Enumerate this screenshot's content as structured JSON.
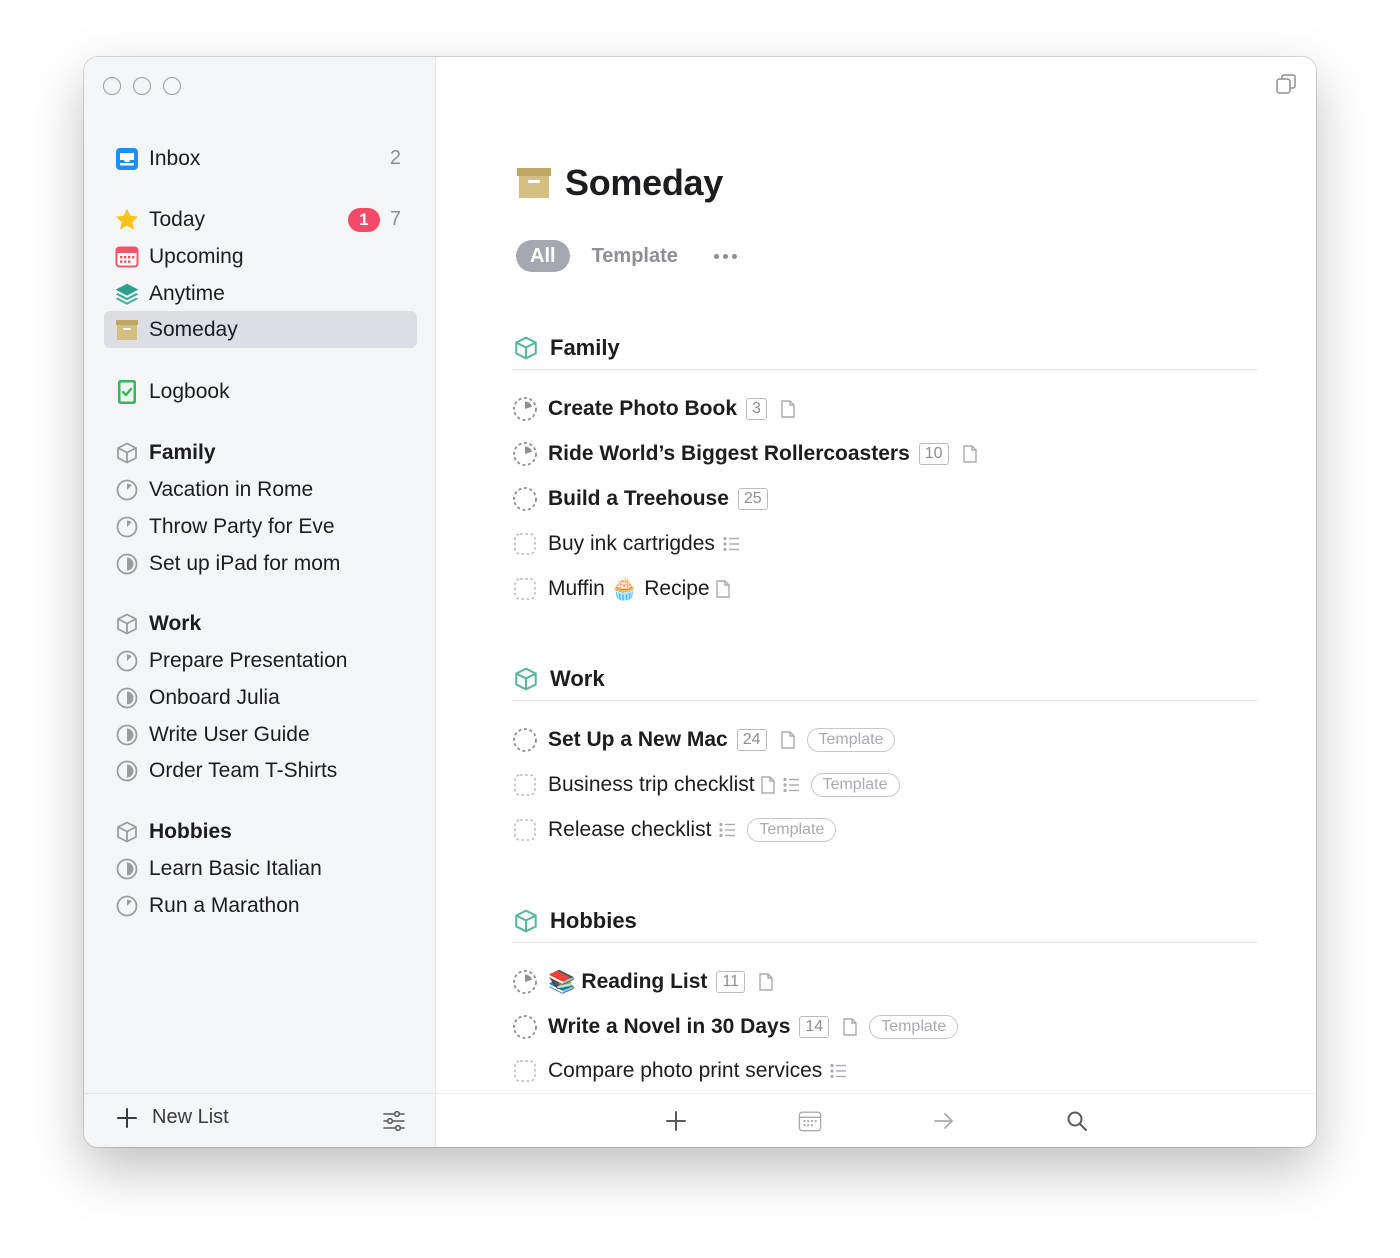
{
  "sidebar": {
    "inbox": {
      "label": "Inbox",
      "count": "2"
    },
    "today": {
      "label": "Today",
      "badge": "1",
      "count": "7"
    },
    "upcoming": {
      "label": "Upcoming"
    },
    "anytime": {
      "label": "Anytime"
    },
    "someday": {
      "label": "Someday"
    },
    "logbook": {
      "label": "Logbook"
    },
    "areas": [
      {
        "label": "Family",
        "projects": [
          "Vacation in Rome",
          "Throw Party for Eve",
          "Set up iPad for mom"
        ]
      },
      {
        "label": "Work",
        "projects": [
          "Prepare Presentation",
          "Onboard Julia",
          "Write User Guide",
          "Order Team T-Shirts"
        ]
      },
      {
        "label": "Hobbies",
        "projects": [
          "Learn Basic Italian",
          "Run a Marathon"
        ]
      }
    ],
    "footer": {
      "new_list": "New List"
    }
  },
  "main": {
    "title": "Someday",
    "tabs": {
      "all": "All",
      "template": "Template"
    },
    "sections": [
      {
        "label": "Family",
        "items": [
          {
            "label": "Create Photo Book",
            "count": "3"
          },
          {
            "label": "Ride World’s Biggest Rollercoasters",
            "count": "10"
          },
          {
            "label": "Build a Treehouse",
            "count": "25"
          },
          {
            "label": "Buy ink cartrigdes"
          },
          {
            "label_before": "Muffin",
            "emoji": "🧁",
            "label_after": "Recipe"
          }
        ]
      },
      {
        "label": "Work",
        "items": [
          {
            "label": "Set Up a New Mac",
            "count": "24",
            "tag": "Template"
          },
          {
            "label": "Business trip checklist",
            "tag": "Template"
          },
          {
            "label": "Release checklist",
            "tag": "Template"
          }
        ]
      },
      {
        "label": "Hobbies",
        "items": [
          {
            "emoji": "📚",
            "label": "Reading List",
            "count": "11"
          },
          {
            "label": "Write a Novel in 30 Days",
            "count": "14",
            "tag": "Template"
          },
          {
            "label": "Compare photo print services"
          }
        ]
      }
    ]
  },
  "icons": {
    "inbox": "inbox-tray-icon",
    "today": "star-icon",
    "upcoming": "calendar-icon",
    "anytime": "layers-icon",
    "someday": "archive-box-icon",
    "logbook": "logbook-check-icon",
    "area": "cube-icon",
    "project": "progress-pie-icon"
  },
  "colors": {
    "accent_blue": "#1f8ef1",
    "today_star": "#f8c21c",
    "today_badge": "#f24a68",
    "upcoming_red": "#f05468",
    "anytime_teal": "#2e9f8f",
    "someday_tan": "#c8b171",
    "logbook_green": "#3bb55d",
    "area_green": "#5ab79a",
    "selection": "#dcdee4"
  }
}
